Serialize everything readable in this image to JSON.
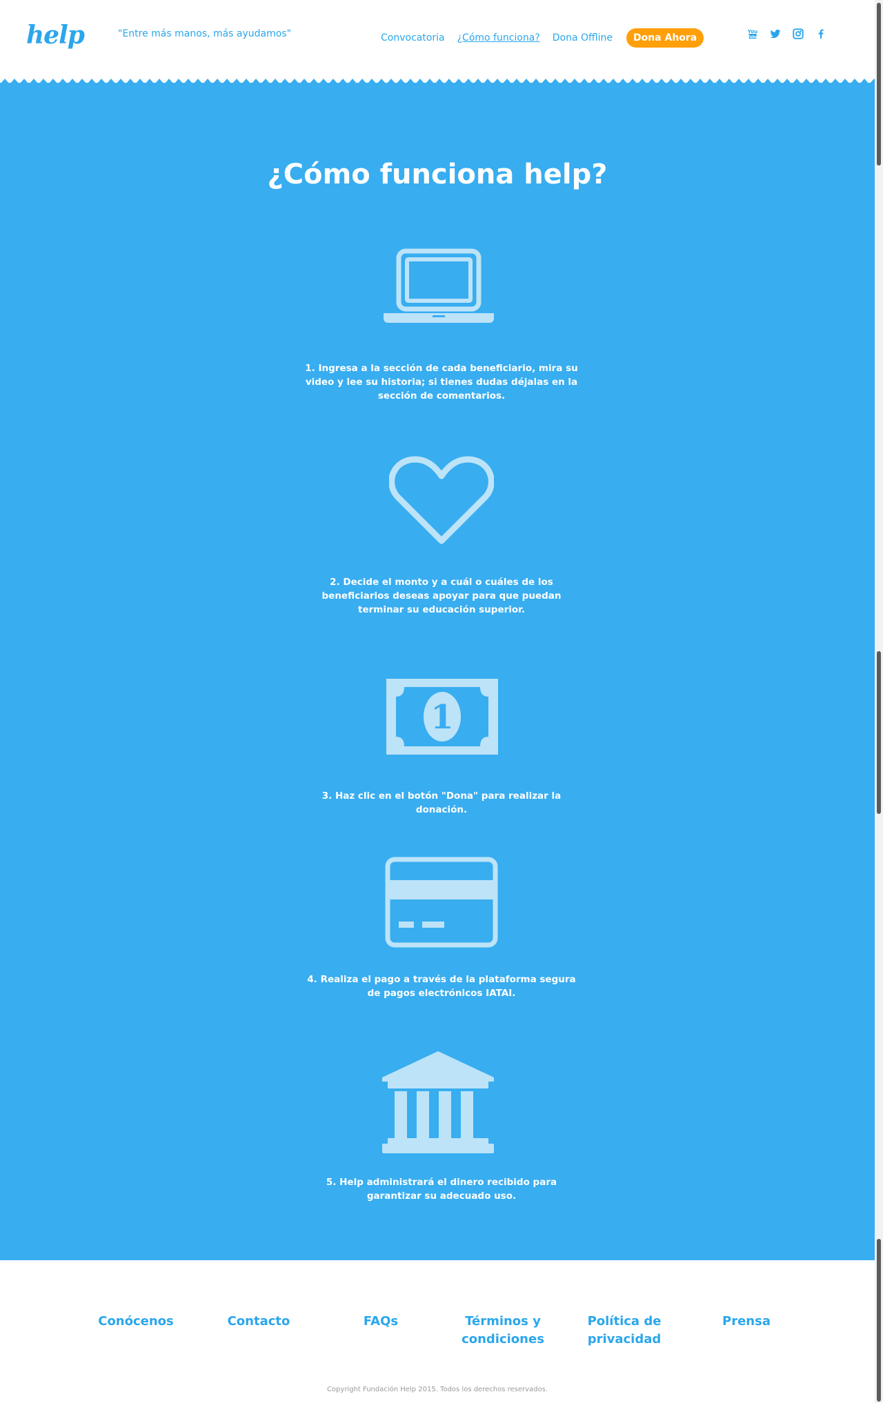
{
  "header": {
    "logo": "help",
    "tagline": "\"Entre más manos, más ayudamos\"",
    "nav": {
      "convocatoria": "Convocatoria",
      "como_funciona": "¿Cómo funciona?",
      "dona_offline": "Dona Offline",
      "dona_ahora": "Dona Ahora"
    },
    "social": [
      "youtube-icon",
      "twitter-icon",
      "instagram-icon",
      "facebook-icon"
    ]
  },
  "main": {
    "title": "¿Cómo funciona help?",
    "steps": [
      {
        "icon": "laptop-icon",
        "text": "1. Ingresa a la sección de cada beneficiario, mira su video y lee su historia; si tienes dudas déjalas en la sección de comentarios."
      },
      {
        "icon": "heart-icon",
        "text": "2. Decide el monto y a cuál o cuáles de los beneficiarios deseas apoyar para que puedan terminar su educación superior."
      },
      {
        "icon": "banknote-icon",
        "text": "3. Haz clic en el botón \"Dona\" para realizar la donación."
      },
      {
        "icon": "credit-card-icon",
        "text": "4. Realiza el pago a través de la plataforma segura de pagos electrónicos IATAI."
      },
      {
        "icon": "bank-building-icon",
        "text": "5. Help administrará el dinero recibido para garantizar su adecuado uso."
      }
    ]
  },
  "footer": {
    "links": {
      "conocenos": "Conócenos",
      "contacto": "Contacto",
      "faqs": "FAQs",
      "terminos": "Términos y condiciones",
      "politica": "Política de privacidad",
      "prensa": "Prensa"
    },
    "copyright": "Copyright Fundación Help 2015. Todos los derechos reservados."
  },
  "colors": {
    "brand_blue": "#2aa6ec",
    "section_blue": "#38adf0",
    "icon_light_blue": "#bde3f8",
    "donate_orange": "#ff9f0a"
  }
}
